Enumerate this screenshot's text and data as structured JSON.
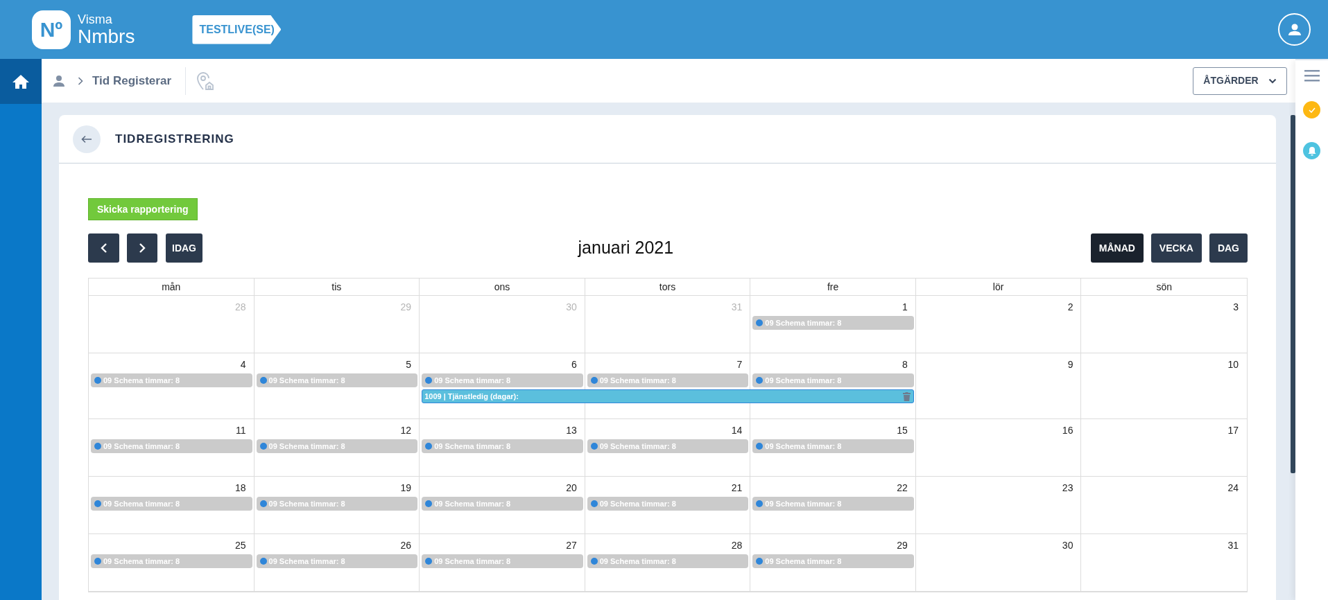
{
  "logo": {
    "mark": "Nº",
    "line1": "Visma",
    "line2": "Nmbrs"
  },
  "company": "TESTLIVE(SE)",
  "breadcrumb": {
    "current": "Tid Registerar"
  },
  "actions_button": "ÅTGÄRDER",
  "page_title": "TIDREGISTRERING",
  "submit_button": "Skicka rapportering",
  "today_button": "IDAG",
  "month_title": "januari 2021",
  "views": [
    {
      "label": "MÅNAD",
      "selected": true
    },
    {
      "label": "VECKA",
      "selected": false
    },
    {
      "label": "DAG",
      "selected": false
    }
  ],
  "weekdays": [
    "mån",
    "tis",
    "ons",
    "tors",
    "fre",
    "lör",
    "sön"
  ],
  "weeks": [
    {
      "days": [
        {
          "date": "28",
          "muted": true
        },
        {
          "date": "29",
          "muted": true
        },
        {
          "date": "30",
          "muted": true
        },
        {
          "date": "31",
          "muted": true
        },
        {
          "date": "1",
          "muted": false,
          "events": [
            "09 Schema timmar: 8"
          ]
        },
        {
          "date": "2",
          "muted": false
        },
        {
          "date": "3",
          "muted": false
        }
      ]
    },
    {
      "days": [
        {
          "date": "4",
          "muted": false,
          "events": [
            "09 Schema timmar: 8"
          ]
        },
        {
          "date": "5",
          "muted": false,
          "events": [
            "09 Schema timmar: 8"
          ]
        },
        {
          "date": "6",
          "muted": false,
          "events": [
            "09 Schema timmar: 8"
          ]
        },
        {
          "date": "7",
          "muted": false,
          "events": [
            "09 Schema timmar: 8"
          ]
        },
        {
          "date": "8",
          "muted": false,
          "events": [
            "09 Schema timmar: 8"
          ]
        },
        {
          "date": "9",
          "muted": false
        },
        {
          "date": "10",
          "muted": false
        }
      ],
      "spanning_events": [
        {
          "label": "1009 | Tjänstledig (dagar):",
          "covers": [
            false,
            false,
            true,
            true,
            true,
            false,
            false
          ]
        }
      ]
    },
    {
      "days": [
        {
          "date": "11",
          "muted": false,
          "events": [
            "09 Schema timmar: 8"
          ]
        },
        {
          "date": "12",
          "muted": false,
          "events": [
            "09 Schema timmar: 8"
          ]
        },
        {
          "date": "13",
          "muted": false,
          "events": [
            "09 Schema timmar: 8"
          ]
        },
        {
          "date": "14",
          "muted": false,
          "events": [
            "09 Schema timmar: 8"
          ]
        },
        {
          "date": "15",
          "muted": false,
          "events": [
            "09 Schema timmar: 8"
          ]
        },
        {
          "date": "16",
          "muted": false
        },
        {
          "date": "17",
          "muted": false
        }
      ]
    },
    {
      "days": [
        {
          "date": "18",
          "muted": false,
          "events": [
            "09 Schema timmar: 8"
          ]
        },
        {
          "date": "19",
          "muted": false,
          "events": [
            "09 Schema timmar: 8"
          ]
        },
        {
          "date": "20",
          "muted": false,
          "events": [
            "09 Schema timmar: 8"
          ]
        },
        {
          "date": "21",
          "muted": false,
          "events": [
            "09 Schema timmar: 8"
          ]
        },
        {
          "date": "22",
          "muted": false,
          "events": [
            "09 Schema timmar: 8"
          ]
        },
        {
          "date": "23",
          "muted": false
        },
        {
          "date": "24",
          "muted": false
        }
      ]
    },
    {
      "days": [
        {
          "date": "25",
          "muted": false,
          "events": [
            "09 Schema timmar: 8"
          ]
        },
        {
          "date": "26",
          "muted": false,
          "events": [
            "09 Schema timmar: 8"
          ]
        },
        {
          "date": "27",
          "muted": false,
          "events": [
            "09 Schema timmar: 8"
          ]
        },
        {
          "date": "28",
          "muted": false,
          "events": [
            "09 Schema timmar: 8"
          ]
        },
        {
          "date": "29",
          "muted": false,
          "events": [
            "09 Schema timmar: 8"
          ]
        },
        {
          "date": "30",
          "muted": false
        },
        {
          "date": "31",
          "muted": false
        }
      ]
    }
  ]
}
